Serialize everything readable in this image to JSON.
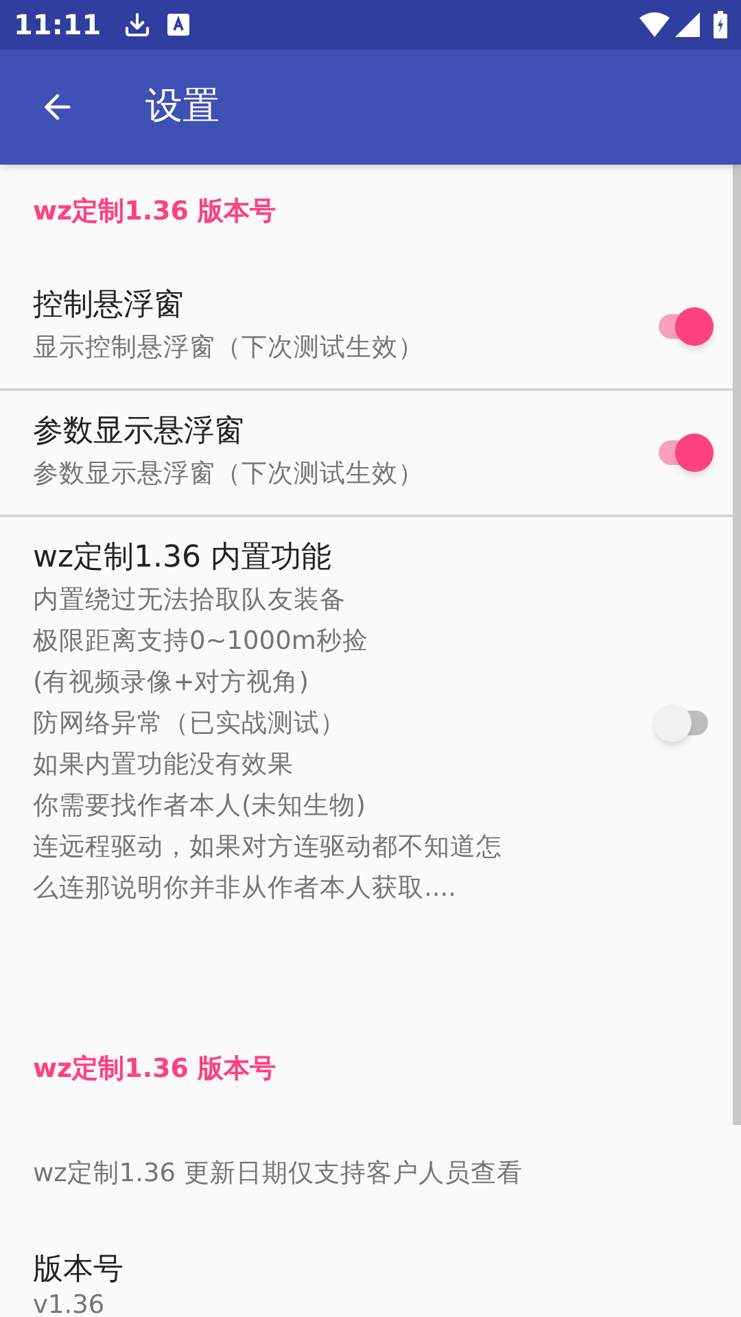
{
  "status_bar": {
    "time": "11:11"
  },
  "toolbar": {
    "title": "设置"
  },
  "sections": [
    {
      "kind": "category",
      "title": "wz定制1.36 版本号"
    },
    {
      "kind": "switch",
      "title": "控制悬浮窗",
      "summary": [
        "显示控制悬浮窗（下次测试生效）"
      ],
      "on": true,
      "divider": true
    },
    {
      "kind": "switch",
      "title": "参数显示悬浮窗",
      "summary": [
        "参数显示悬浮窗（下次测试生效）"
      ],
      "on": true,
      "divider": true
    },
    {
      "kind": "switch",
      "title": "wz定制1.36 内置功能",
      "summary": [
        "内置绕过无法拾取队友装备",
        "极限距离支持0~1000m秒捡",
        "(有视频录像+对方视角)",
        "防网络异常（已实战测试）",
        "如果内置功能没有效果",
        "你需要找作者本人(未知生物)",
        "连远程驱动，如果对方连驱动都不知道怎",
        "么连那说明你并非从作者本人获取...."
      ],
      "on": false,
      "divider": false
    },
    {
      "kind": "category",
      "title": "wz定制1.36 版本号"
    },
    {
      "kind": "info",
      "summary": [
        "wz定制1.36 更新日期仅支持客户人员查看"
      ]
    },
    {
      "kind": "item",
      "title": "版本号",
      "summary": [
        "v1.36"
      ]
    }
  ]
}
